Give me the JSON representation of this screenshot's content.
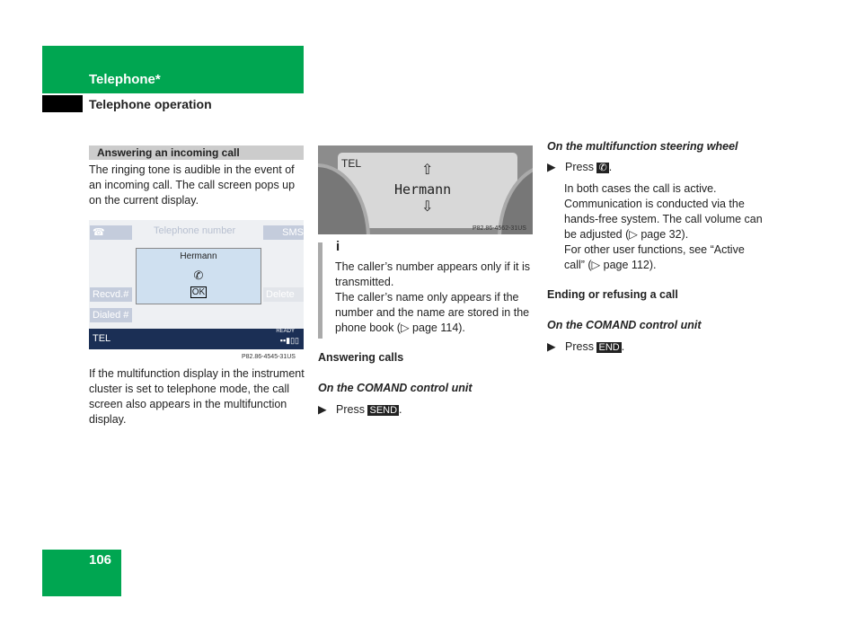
{
  "header": {
    "title": "Telephone*",
    "subtitle": "Telephone operation"
  },
  "page_number": "106",
  "left": {
    "section_title": "Answering an incoming call",
    "intro": "The ringing tone is audible in the event of an incoming call. The call screen pops up on the current display.",
    "screen": {
      "phone_icon": "phone-icon",
      "title": "Telephone number",
      "sms": "SMS",
      "caller": "Hermann",
      "ok": "OK",
      "recvd": "Recvd.#",
      "delete": "Delete",
      "dialed": "Dialed #",
      "status_label": "TEL",
      "ready": "READY",
      "caption": "P82.86-4545-31US"
    },
    "para": "If the multifunction display in the instrument cluster is set to telephone mode, the call screen also appears in the multifunction display."
  },
  "middle": {
    "cluster": {
      "label": "TEL",
      "caller": "Hermann",
      "caption": "P82.86-4562-31US"
    },
    "note_lines": [
      "The caller’s number appears only if it is transmitted.",
      "The caller’s name only appears if the number and the name are stored in the phone book (▷ page 114)."
    ],
    "answering": "Answering calls",
    "comand": "On the COMAND control unit",
    "press": "Press",
    "send_key": "SEND"
  },
  "right": {
    "steering": "On the multifunction steering wheel",
    "press": "Press",
    "body": "In both cases the call is active. Communication is conducted via the hands-free system. The call volume can be adjusted (▷ page 32).",
    "other": "For other user functions, see “Active call” (▷ page 112).",
    "ending": "Ending or refusing a call",
    "comand": "On the COMAND control unit",
    "press2": "Press",
    "end_key": "END"
  }
}
